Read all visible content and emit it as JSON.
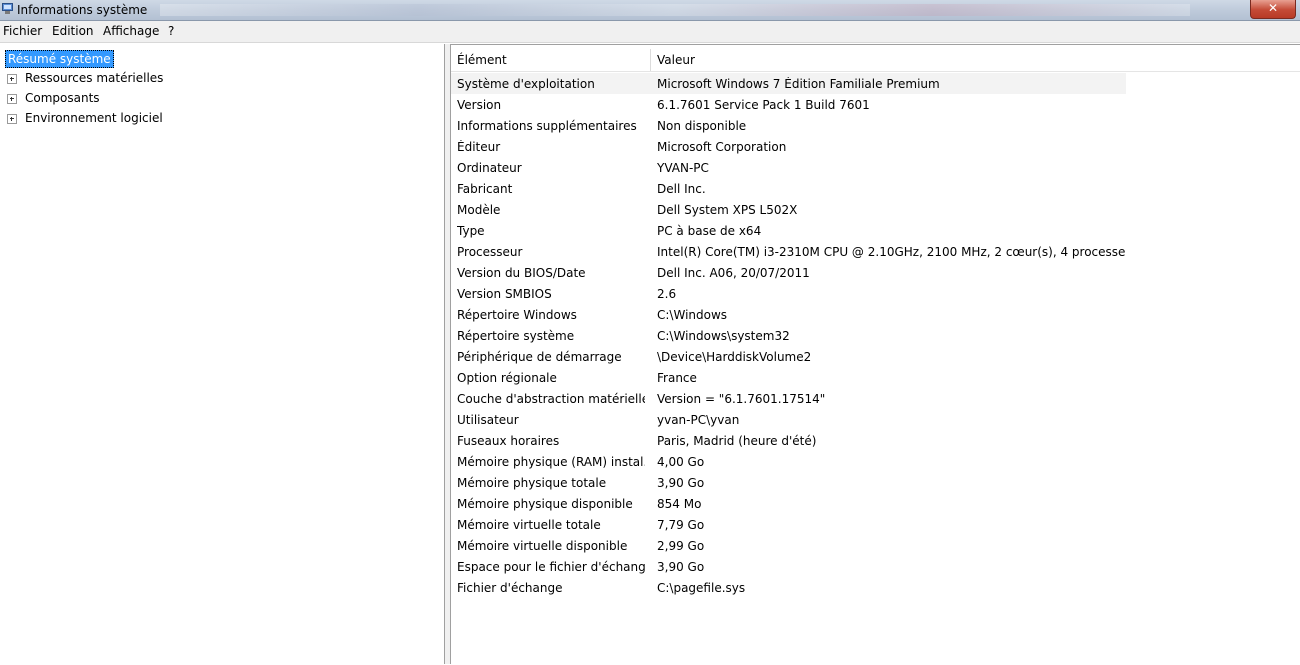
{
  "window": {
    "title": "Informations système",
    "close_label": "✕"
  },
  "menu": [
    "Fichier",
    "Edition",
    "Affichage",
    "?"
  ],
  "tree": {
    "root": "Résumé système",
    "children": [
      "Ressources matérielles",
      "Composants",
      "Environnement logiciel"
    ]
  },
  "table": {
    "headers": [
      "Élément",
      "Valeur"
    ],
    "rows": [
      [
        "Système d'exploitation",
        "Microsoft Windows 7 Édition Familiale Premium"
      ],
      [
        "Version",
        "6.1.7601 Service Pack 1 Build 7601"
      ],
      [
        "Informations supplémentaires",
        "Non disponible"
      ],
      [
        "Éditeur",
        "Microsoft Corporation"
      ],
      [
        "Ordinateur",
        "YVAN-PC"
      ],
      [
        "Fabricant",
        "Dell Inc."
      ],
      [
        "Modèle",
        "Dell System XPS L502X"
      ],
      [
        "Type",
        "PC à base de x64"
      ],
      [
        "Processeur",
        "Intel(R) Core(TM) i3-2310M CPU @ 2.10GHz, 2100 MHz, 2 cœur(s), 4 processe..."
      ],
      [
        "Version du BIOS/Date",
        "Dell Inc. A06, 20/07/2011"
      ],
      [
        "Version SMBIOS",
        "2.6"
      ],
      [
        "Répertoire Windows",
        "C:\\Windows"
      ],
      [
        "Répertoire système",
        "C:\\Windows\\system32"
      ],
      [
        "Périphérique de démarrage",
        "\\Device\\HarddiskVolume2"
      ],
      [
        "Option régionale",
        "France"
      ],
      [
        "Couche d'abstraction matérielle",
        "Version = \"6.1.7601.17514\""
      ],
      [
        "Utilisateur",
        "yvan-PC\\yvan"
      ],
      [
        "Fuseaux horaires",
        "Paris, Madrid (heure d'été)"
      ],
      [
        "Mémoire physique (RAM) instal...",
        "4,00 Go"
      ],
      [
        "Mémoire physique totale",
        "3,90 Go"
      ],
      [
        "Mémoire physique disponible",
        "854 Mo"
      ],
      [
        "Mémoire virtuelle totale",
        "7,79 Go"
      ],
      [
        "Mémoire virtuelle disponible",
        "2,99 Go"
      ],
      [
        "Espace pour le fichier d'échange",
        "3,90 Go"
      ],
      [
        "Fichier d'échange",
        "C:\\pagefile.sys"
      ]
    ]
  },
  "colors": {
    "selection": "#3399ff",
    "first_row": "#f3f3f3"
  }
}
